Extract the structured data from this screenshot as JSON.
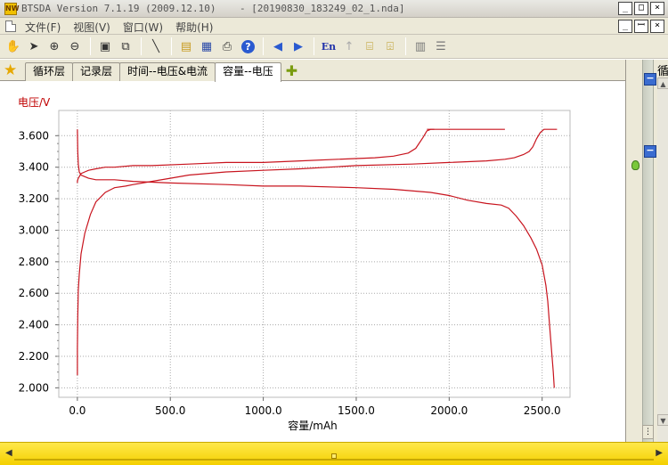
{
  "window": {
    "app_icon_text": "NW",
    "title": "BTSDA Version 7.1.19 (2009.12.10)    - [20190830_183249_02_1.nda]",
    "buttons": [
      "_",
      "□",
      "×"
    ],
    "mdi_buttons": [
      "_",
      "ꟷ",
      "×"
    ]
  },
  "menubar": {
    "items": [
      "文件(F)",
      "视图(V)",
      "窗口(W)",
      "帮助(H)"
    ]
  },
  "toolbar": {
    "buttons": [
      {
        "icon": "hand-icon",
        "glyph": "✋"
      },
      {
        "icon": "pointer-icon",
        "glyph": "➤"
      },
      {
        "icon": "zoom-in-icon",
        "glyph": "⊕"
      },
      {
        "icon": "zoom-out-icon",
        "glyph": "⊖"
      },
      {
        "icon": "reset-icon",
        "glyph": "▣"
      },
      {
        "icon": "copy-chart-icon",
        "glyph": "⧉"
      },
      {
        "icon": "pen-icon",
        "glyph": "╲"
      },
      {
        "icon": "open-folder-icon",
        "glyph": "▤"
      },
      {
        "icon": "save-icon",
        "glyph": "▦"
      },
      {
        "icon": "print-icon",
        "glyph": "⎙"
      },
      {
        "icon": "help-icon",
        "glyph": "?"
      },
      {
        "icon": "back-icon",
        "glyph": "◀"
      },
      {
        "icon": "forward-icon",
        "glyph": "▶"
      },
      {
        "icon": "language-icon",
        "glyph": "En"
      },
      {
        "icon": "up-arrow-icon",
        "glyph": "↑"
      },
      {
        "icon": "export-excel-icon",
        "glyph": "⌸"
      },
      {
        "icon": "export-table-icon",
        "glyph": "⌹"
      },
      {
        "icon": "grid-icon",
        "glyph": "▥"
      },
      {
        "icon": "list-icon",
        "glyph": "☰"
      }
    ]
  },
  "tabs": {
    "items": [
      "循环层",
      "记录层",
      "时间--电压&电流",
      "容量--电压"
    ],
    "active_index": 3
  },
  "right_panel": {
    "label": "循"
  },
  "colors": {
    "curve": "#c8141e",
    "axis_title": "#c00000",
    "grid": "#aaaaaa",
    "frame": "#bbbbbb"
  },
  "chart_data": {
    "type": "line",
    "title": "",
    "xlabel": "容量/mAh",
    "ylabel": "电压/V",
    "xlim": [
      -100,
      2650
    ],
    "ylim": [
      1.94,
      3.76
    ],
    "x_ticks": [
      0,
      500,
      1000,
      1500,
      2000,
      2500
    ],
    "x_tick_labels": [
      "0.0",
      "500.0",
      "1000.0",
      "1500.0",
      "2000.0",
      "2500.0"
    ],
    "y_ticks": [
      2.0,
      2.2,
      2.4,
      2.6,
      2.8,
      3.0,
      3.2,
      3.4,
      3.6
    ],
    "y_tick_labels": [
      "2.000",
      "2.200",
      "2.400",
      "2.600",
      "2.800",
      "3.000",
      "3.200",
      "3.400",
      "3.600"
    ],
    "grid": true,
    "series": [
      {
        "x": [
          0,
          0,
          2,
          5,
          10,
          20,
          40,
          60,
          100,
          150,
          200,
          300,
          400,
          600,
          800,
          1000,
          1200,
          1400,
          1600,
          1700,
          1780,
          1820,
          1860,
          1880,
          1900,
          1920
        ],
        "y": [
          3.3,
          3.31,
          3.32,
          3.33,
          3.34,
          3.36,
          3.37,
          3.38,
          3.39,
          3.4,
          3.4,
          3.41,
          3.41,
          3.42,
          3.43,
          3.43,
          3.44,
          3.45,
          3.46,
          3.47,
          3.49,
          3.52,
          3.59,
          3.63,
          3.64,
          3.64
        ]
      },
      {
        "x": [
          1880,
          1900,
          1920,
          1960,
          2000,
          2050,
          2100,
          2200,
          2300
        ],
        "y": [
          3.64,
          3.64,
          3.64,
          3.64,
          3.64,
          3.64,
          3.64,
          3.64,
          3.64
        ]
      },
      {
        "x": [
          0,
          2,
          5,
          10,
          20,
          40,
          60,
          100,
          200,
          300,
          500,
          800,
          1000,
          1200,
          1500,
          1700,
          1900,
          2000,
          2100,
          2200,
          2280,
          2320,
          2360,
          2400,
          2440,
          2470,
          2500,
          2520,
          2530,
          2540,
          2550,
          2560,
          2565
        ],
        "y": [
          3.64,
          3.5,
          3.42,
          3.37,
          3.35,
          3.34,
          3.33,
          3.32,
          3.32,
          3.31,
          3.3,
          3.29,
          3.28,
          3.28,
          3.27,
          3.26,
          3.24,
          3.22,
          3.19,
          3.17,
          3.16,
          3.14,
          3.09,
          3.03,
          2.95,
          2.88,
          2.78,
          2.65,
          2.55,
          2.4,
          2.25,
          2.1,
          2.0
        ]
      },
      {
        "x": [
          0,
          0,
          2,
          5,
          10,
          20,
          40,
          70,
          100,
          150,
          200,
          260,
          300,
          400,
          500,
          600,
          800,
          1000,
          1200,
          1500,
          1800,
          2000,
          2200,
          2300,
          2350,
          2400,
          2430,
          2450,
          2470,
          2490,
          2510,
          2540,
          2580
        ],
        "y": [
          2.08,
          2.25,
          2.45,
          2.62,
          2.72,
          2.85,
          2.98,
          3.1,
          3.18,
          3.24,
          3.27,
          3.28,
          3.29,
          3.31,
          3.33,
          3.35,
          3.37,
          3.38,
          3.39,
          3.41,
          3.42,
          3.43,
          3.44,
          3.45,
          3.46,
          3.48,
          3.5,
          3.53,
          3.58,
          3.62,
          3.64,
          3.64,
          3.64
        ]
      }
    ]
  },
  "bottom_bar": {
    "left_arrow": "◀",
    "right_arrow": "▶"
  }
}
